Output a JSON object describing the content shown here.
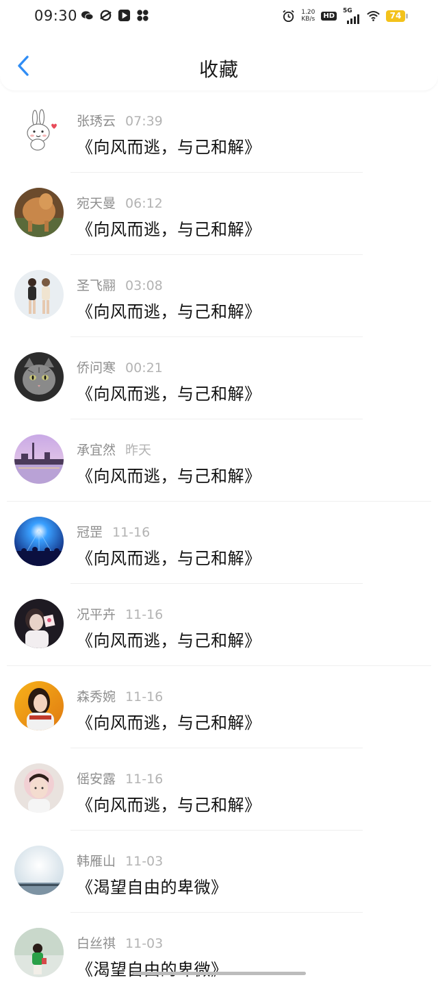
{
  "status_bar": {
    "time": "09:30",
    "net_speed_value": "1.20",
    "net_speed_unit": "KB/s",
    "hd": "HD",
    "network": "5G",
    "battery": "74",
    "battery_color": "#f3c21b"
  },
  "header": {
    "title": "收藏",
    "accent": "#2f8df5"
  },
  "items": [
    {
      "name": "张琇云",
      "time": "07:39",
      "content": "《向风而逃，与己和解》"
    },
    {
      "name": "宛天曼",
      "time": "06:12",
      "content": "《向风而逃，与己和解》"
    },
    {
      "name": "圣飞翮",
      "time": "03:08",
      "content": "《向风而逃，与己和解》"
    },
    {
      "name": "侨问寒",
      "time": "00:21",
      "content": "《向风而逃，与己和解》"
    },
    {
      "name": "承宜然",
      "time": "昨天",
      "content": "《向风而逃，与己和解》"
    },
    {
      "name": "冠罡",
      "time": "11-16",
      "content": "《向风而逃，与己和解》"
    },
    {
      "name": "况平卉",
      "time": "11-16",
      "content": "《向风而逃，与己和解》"
    },
    {
      "name": "森秀婉",
      "time": "11-16",
      "content": "《向风而逃，与己和解》"
    },
    {
      "name": "傜安露",
      "time": "11-16",
      "content": "《向风而逃，与己和解》"
    },
    {
      "name": "韩雁山",
      "time": "11-03",
      "content": "《渴望自由的卑微》"
    },
    {
      "name": "白丝祺",
      "time": "11-03",
      "content": "《渴望自由的卑微》"
    }
  ]
}
